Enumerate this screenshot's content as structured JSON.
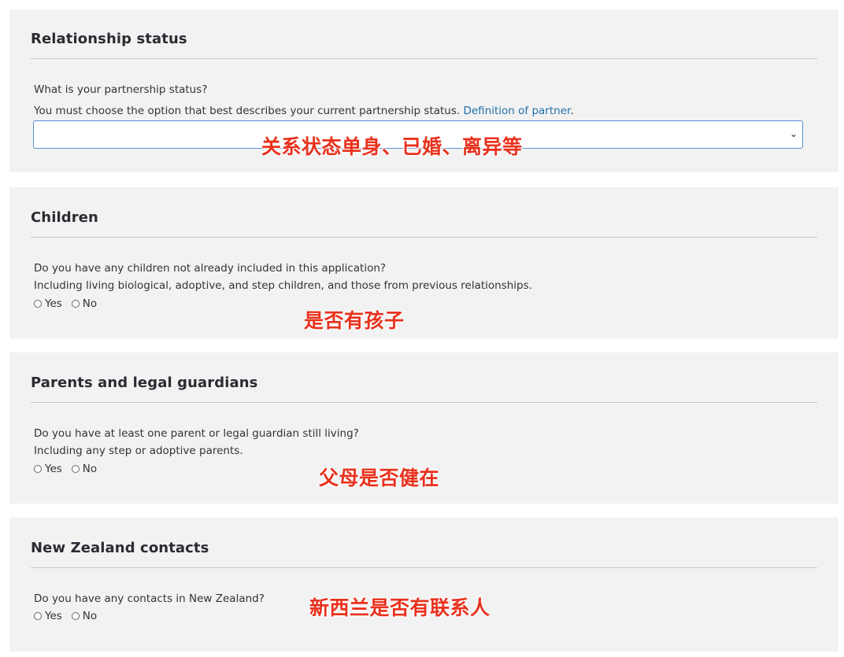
{
  "sections": [
    {
      "title": "Relationship status",
      "question": "What is your partnership status?",
      "hint": "You must choose the option that best describes your current partnership status.",
      "hint_link": "Definition of partner",
      "hint_end": ".",
      "select_value": "",
      "annotation": "关系状态单身、已婚、离异等"
    },
    {
      "title": "Children",
      "question": "Do you have any children not already included in this application?",
      "hint": "Including living biological, adoptive, and step children, and those from previous relationships.",
      "yes": "Yes",
      "no": "No",
      "annotation": "是否有孩子"
    },
    {
      "title": "Parents and legal guardians",
      "question": "Do you have at least one parent or legal guardian still living?",
      "hint": "Including any step or adoptive parents.",
      "yes": "Yes",
      "no": "No",
      "annotation": "父母是否健在"
    },
    {
      "title": "New Zealand contacts",
      "question": "Do you have any contacts in New Zealand?",
      "yes": "Yes",
      "no": "No",
      "annotation": "新西兰是否有联系人"
    }
  ],
  "colors": {
    "panel_bg": "#f2f2f2",
    "link": "#1f6fa8",
    "annotation": "#e8321e",
    "select_border": "#5a8fd6"
  }
}
